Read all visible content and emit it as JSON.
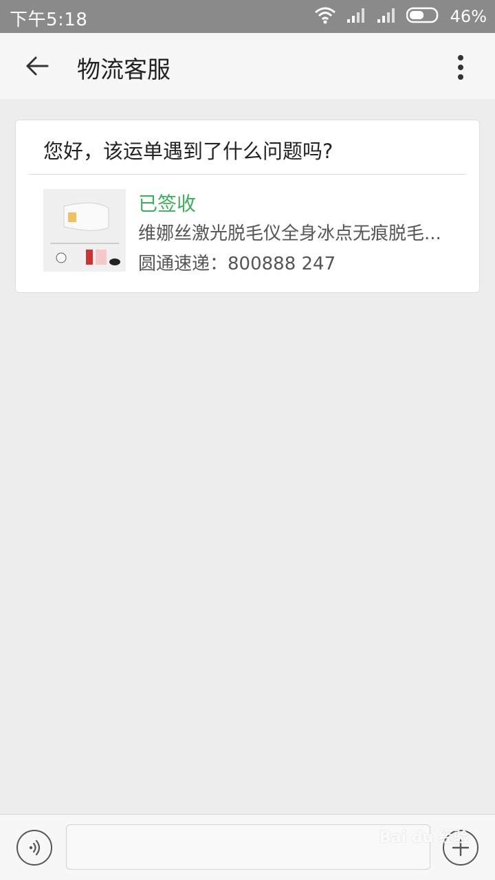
{
  "status_bar": {
    "time": "下午5:18",
    "battery": "46%"
  },
  "header": {
    "title": "物流客服"
  },
  "card": {
    "question": "您好，该运单遇到了什么问题吗?",
    "status": "已签收",
    "product_title": "维娜丝激光脱毛仪全身冰点无痕脱毛...",
    "courier": "圆通速递：800888     247"
  },
  "input": {
    "placeholder": ""
  },
  "watermark": "Bai du 经验",
  "colors": {
    "status_green": "#3cae5c",
    "status_bar": "#8a8a8a"
  }
}
